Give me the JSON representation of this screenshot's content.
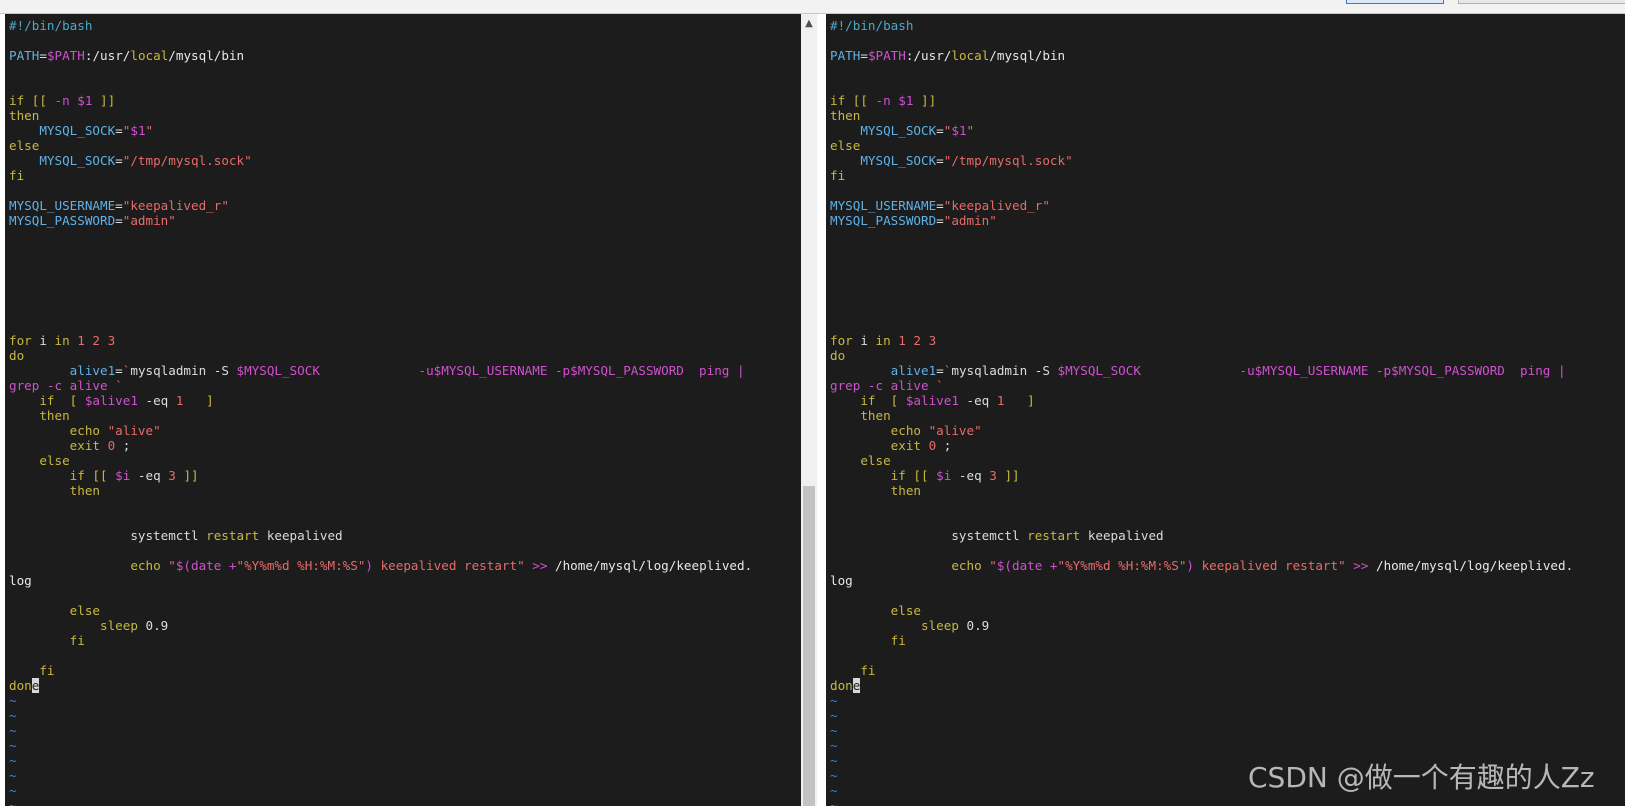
{
  "editor": {
    "lines": [
      [
        {
          "c": "comment",
          "t": "#!/bin/bash"
        }
      ],
      [],
      [
        {
          "c": "var",
          "t": "PATH"
        },
        {
          "c": "plain",
          "t": "="
        },
        {
          "c": "dollar",
          "t": "$PATH"
        },
        {
          "c": "path",
          "t": ":/usr/"
        },
        {
          "c": "keyword",
          "t": "local"
        },
        {
          "c": "path",
          "t": "/mysql/bin"
        }
      ],
      [],
      [],
      [
        {
          "c": "keyword",
          "t": "if [[ "
        },
        {
          "c": "magenta",
          "t": "-n $1"
        },
        {
          "c": "keyword",
          "t": " ]]"
        }
      ],
      [
        {
          "c": "keyword",
          "t": "then"
        }
      ],
      [
        {
          "c": "plain",
          "t": "    "
        },
        {
          "c": "var",
          "t": "MYSQL_SOCK"
        },
        {
          "c": "plain",
          "t": "="
        },
        {
          "c": "string",
          "t": "\""
        },
        {
          "c": "dollar",
          "t": "$1"
        },
        {
          "c": "string",
          "t": "\""
        }
      ],
      [
        {
          "c": "keyword",
          "t": "else"
        }
      ],
      [
        {
          "c": "plain",
          "t": "    "
        },
        {
          "c": "var",
          "t": "MYSQL_SOCK"
        },
        {
          "c": "plain",
          "t": "="
        },
        {
          "c": "string",
          "t": "\"/tmp/mysql.sock\""
        }
      ],
      [
        {
          "c": "keyword",
          "t": "fi"
        }
      ],
      [],
      [
        {
          "c": "var",
          "t": "MYSQL_USERNAME"
        },
        {
          "c": "plain",
          "t": "="
        },
        {
          "c": "string",
          "t": "\"keepalived_r\""
        }
      ],
      [
        {
          "c": "var",
          "t": "MYSQL_PASSWORD"
        },
        {
          "c": "plain",
          "t": "="
        },
        {
          "c": "string",
          "t": "\"admin\""
        }
      ],
      [],
      [],
      [],
      [],
      [],
      [],
      [],
      [
        {
          "c": "keyword",
          "t": "for "
        },
        {
          "c": "plain",
          "t": "i "
        },
        {
          "c": "keyword",
          "t": "in "
        },
        {
          "c": "string",
          "t": "1 2 3"
        }
      ],
      [
        {
          "c": "keyword",
          "t": "do"
        }
      ],
      [
        {
          "c": "plain",
          "t": "        "
        },
        {
          "c": "var",
          "t": "alive1"
        },
        {
          "c": "plain",
          "t": "="
        },
        {
          "c": "string",
          "t": "`"
        },
        {
          "c": "plain",
          "t": "mysqladmin -S "
        },
        {
          "c": "dollar",
          "t": "$MYSQL_SOCK"
        },
        {
          "c": "plain",
          "t": "             "
        },
        {
          "c": "magenta",
          "t": "-u$MYSQL_USERNAME -p$MYSQL_PASSWORD  ping |"
        }
      ],
      [
        {
          "c": "magenta",
          "t": "grep -c alive "
        },
        {
          "c": "string",
          "t": "`"
        }
      ],
      [
        {
          "c": "keyword",
          "t": "    if  [ "
        },
        {
          "c": "dollar",
          "t": "$alive1"
        },
        {
          "c": "plain",
          "t": " -eq "
        },
        {
          "c": "string",
          "t": "1"
        },
        {
          "c": "keyword",
          "t": "   ]"
        }
      ],
      [
        {
          "c": "keyword",
          "t": "    then"
        }
      ],
      [
        {
          "c": "plain",
          "t": "        "
        },
        {
          "c": "keyword",
          "t": "echo "
        },
        {
          "c": "string",
          "t": "\"alive\""
        }
      ],
      [
        {
          "c": "plain",
          "t": "        "
        },
        {
          "c": "keyword",
          "t": "exit "
        },
        {
          "c": "string",
          "t": "0"
        },
        {
          "c": "plain",
          "t": " ;"
        }
      ],
      [
        {
          "c": "keyword",
          "t": "    else"
        }
      ],
      [
        {
          "c": "plain",
          "t": "        "
        },
        {
          "c": "keyword",
          "t": "if [[ "
        },
        {
          "c": "dollar",
          "t": "$i"
        },
        {
          "c": "plain",
          "t": " -eq "
        },
        {
          "c": "string",
          "t": "3"
        },
        {
          "c": "keyword",
          "t": " ]]"
        }
      ],
      [
        {
          "c": "keyword",
          "t": "        then"
        }
      ],
      [],
      [],
      [
        {
          "c": "plain",
          "t": "                systemctl "
        },
        {
          "c": "keyword",
          "t": "restart "
        },
        {
          "c": "plain",
          "t": "keepalived"
        }
      ],
      [],
      [
        {
          "c": "plain",
          "t": "                "
        },
        {
          "c": "keyword",
          "t": "echo "
        },
        {
          "c": "string",
          "t": "\""
        },
        {
          "c": "magenta",
          "t": "$(date +"
        },
        {
          "c": "string",
          "t": "\"%Y%m%d %H:%M:%S\""
        },
        {
          "c": "magenta",
          "t": ")"
        },
        {
          "c": "string",
          "t": " keepalived restart\""
        },
        {
          "c": "magenta",
          "t": " >> "
        },
        {
          "c": "path",
          "t": "/home/mysql/log/keeplived."
        }
      ],
      [
        {
          "c": "path",
          "t": "log"
        }
      ],
      [],
      [
        {
          "c": "keyword",
          "t": "        else"
        }
      ],
      [
        {
          "c": "plain",
          "t": "            "
        },
        {
          "c": "keyword",
          "t": "sleep "
        },
        {
          "c": "plain",
          "t": "0.9"
        }
      ],
      [
        {
          "c": "keyword",
          "t": "        fi"
        }
      ],
      [],
      [
        {
          "c": "keyword",
          "t": "    fi"
        }
      ],
      [
        {
          "c": "keyword",
          "t": "don"
        },
        {
          "c": "cursor",
          "t": "e"
        }
      ],
      [
        {
          "c": "tilde",
          "t": "~"
        }
      ],
      [
        {
          "c": "tilde",
          "t": "~"
        }
      ],
      [
        {
          "c": "tilde",
          "t": "~"
        }
      ],
      [
        {
          "c": "tilde",
          "t": "~"
        }
      ],
      [
        {
          "c": "tilde",
          "t": "~"
        }
      ],
      [
        {
          "c": "tilde",
          "t": "~"
        }
      ],
      [
        {
          "c": "tilde",
          "t": "~"
        }
      ],
      [
        {
          "c": "tilde",
          "t": "~"
        }
      ]
    ]
  },
  "watermark": "CSDN @做一个有趣的人Zz",
  "scrollbar": {
    "up_arrow": "▲"
  }
}
